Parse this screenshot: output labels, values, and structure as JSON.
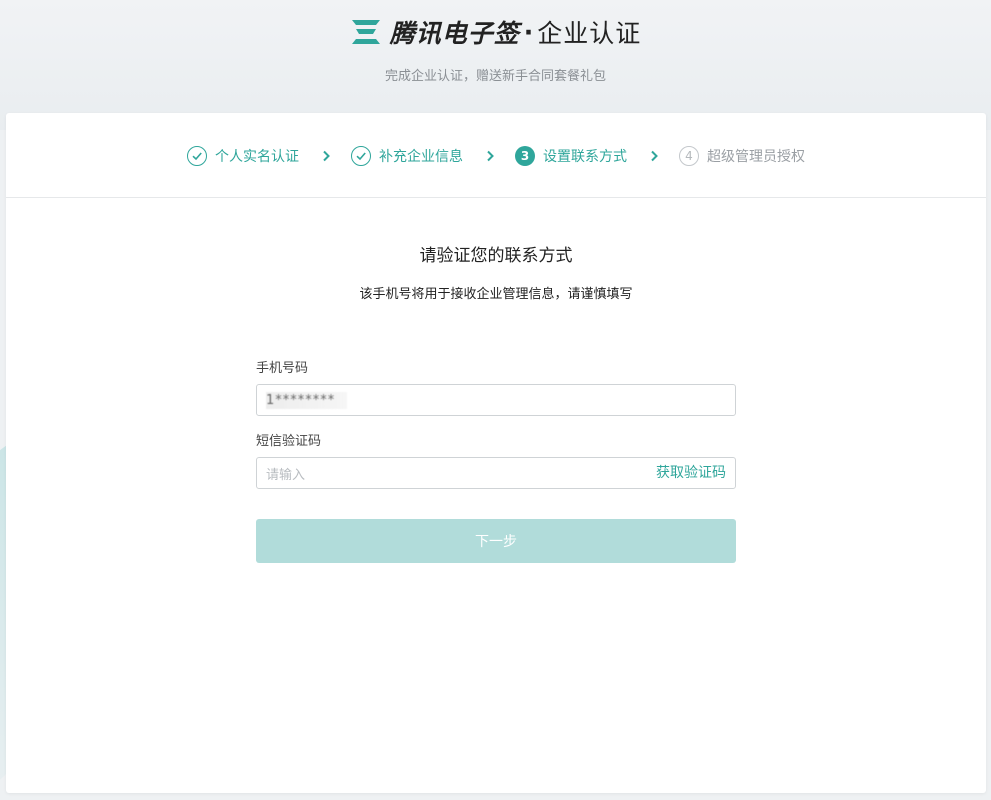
{
  "header": {
    "brand_name": "腾讯电子签",
    "brand_dot": "·",
    "brand_suffix": "企业认证",
    "subtitle": "完成企业认证，赠送新手合同套餐礼包",
    "logo_icon": "tencent-esign-logo-icon",
    "brand_color": "#2fa69b"
  },
  "steps": [
    {
      "num": "",
      "label": "个人实名认证",
      "status": "done",
      "icon": "check-circle-icon"
    },
    {
      "num": "",
      "label": "补充企业信息",
      "status": "done",
      "icon": "check-circle-icon"
    },
    {
      "num": "3",
      "label": "设置联系方式",
      "status": "active"
    },
    {
      "num": "4",
      "label": "超级管理员授权",
      "status": "pending"
    }
  ],
  "main": {
    "title": "请验证您的联系方式",
    "description": "该手机号将用于接收企业管理信息，请谨慎填写"
  },
  "form": {
    "phone_label": "手机号码",
    "phone_value": "1********",
    "code_label": "短信验证码",
    "code_placeholder": "请输入",
    "get_code_label": "获取验证码",
    "next_label": "下一步"
  },
  "colors": {
    "accent": "#2fa69b",
    "button_disabled": "#b1dcda"
  }
}
